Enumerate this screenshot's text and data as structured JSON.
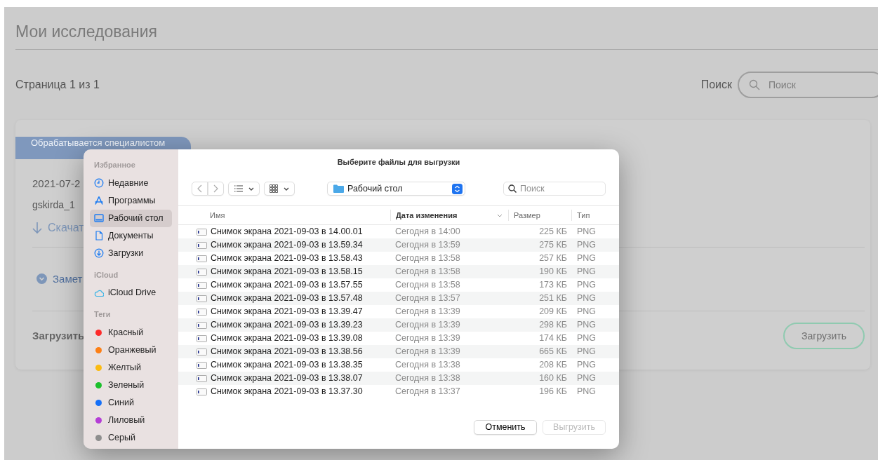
{
  "page": {
    "title": "Мои исследования",
    "pagination": "Страница 1 из 1",
    "search_label": "Поиск",
    "search": {
      "placeholder": "Поиск"
    },
    "card": {
      "status": "Обрабатывается специалистом",
      "date": "2021-07-2",
      "user": "gskirda_1",
      "download_link": "Скачат",
      "notes_toggle": "Замет",
      "upload_label": "Загрузить",
      "upload_button": "Загрузить"
    }
  },
  "dialog": {
    "title": "Выберите файлы для выгрузки",
    "location": "Рабочий стол",
    "search": {
      "placeholder": "Поиск"
    },
    "sidebar": [
      {
        "heading": "Избранное",
        "items": [
          {
            "label": "Недавние",
            "kind": "clock",
            "selected": false
          },
          {
            "label": "Программы",
            "kind": "apps",
            "selected": false
          },
          {
            "label": "Рабочий стол",
            "kind": "desktop",
            "selected": true
          },
          {
            "label": "Документы",
            "kind": "document",
            "selected": false
          },
          {
            "label": "Загрузки",
            "kind": "download",
            "selected": false
          }
        ]
      },
      {
        "heading": "iCloud",
        "items": [
          {
            "label": "iCloud Drive",
            "kind": "cloud",
            "selected": false
          }
        ]
      },
      {
        "heading": "Теги",
        "items": [
          {
            "label": "Красный",
            "kind": "tag",
            "color": "#fe2b2b",
            "selected": false
          },
          {
            "label": "Оранжевый",
            "kind": "tag",
            "color": "#fd7f16",
            "selected": false
          },
          {
            "label": "Желтый",
            "kind": "tag",
            "color": "#fbbb12",
            "selected": false
          },
          {
            "label": "Зеленый",
            "kind": "tag",
            "color": "#1cc02c",
            "selected": false
          },
          {
            "label": "Синий",
            "kind": "tag",
            "color": "#1670f8",
            "selected": false
          },
          {
            "label": "Лиловый",
            "kind": "tag",
            "color": "#b53ed6",
            "selected": false
          },
          {
            "label": "Серый",
            "kind": "tag",
            "color": "#8e8e8e",
            "selected": false
          }
        ]
      }
    ],
    "columns": [
      {
        "label": "Имя",
        "sorted": false
      },
      {
        "label": "Дата изменения",
        "sorted": true
      },
      {
        "label": "Размер",
        "sorted": false
      },
      {
        "label": "Тип",
        "sorted": false
      }
    ],
    "files": [
      {
        "name": "Снимок экрана 2021-09-03 в 14.00.01",
        "date": "Сегодня в 14:00",
        "size": "225 КБ",
        "type": "PNG"
      },
      {
        "name": "Снимок экрана 2021-09-03 в 13.59.34",
        "date": "Сегодня в 13:59",
        "size": "275 КБ",
        "type": "PNG"
      },
      {
        "name": "Снимок экрана 2021-09-03 в 13.58.43",
        "date": "Сегодня в 13:58",
        "size": "257 КБ",
        "type": "PNG"
      },
      {
        "name": "Снимок экрана 2021-09-03 в 13.58.15",
        "date": "Сегодня в 13:58",
        "size": "190 КБ",
        "type": "PNG"
      },
      {
        "name": "Снимок экрана 2021-09-03 в 13.57.55",
        "date": "Сегодня в 13:58",
        "size": "173 КБ",
        "type": "PNG"
      },
      {
        "name": "Снимок экрана 2021-09-03 в 13.57.48",
        "date": "Сегодня в 13:57",
        "size": "251 КБ",
        "type": "PNG"
      },
      {
        "name": "Снимок экрана 2021-09-03 в 13.39.47",
        "date": "Сегодня в 13:39",
        "size": "209 КБ",
        "type": "PNG"
      },
      {
        "name": "Снимок экрана 2021-09-03 в 13.39.23",
        "date": "Сегодня в 13:39",
        "size": "298 КБ",
        "type": "PNG"
      },
      {
        "name": "Снимок экрана 2021-09-03 в 13.39.08",
        "date": "Сегодня в 13:39",
        "size": "174 КБ",
        "type": "PNG"
      },
      {
        "name": "Снимок экрана 2021-09-03 в 13.38.56",
        "date": "Сегодня в 13:39",
        "size": "665 КБ",
        "type": "PNG"
      },
      {
        "name": "Снимок экрана 2021-09-03 в 13.38.35",
        "date": "Сегодня в 13:38",
        "size": "208 КБ",
        "type": "PNG"
      },
      {
        "name": "Снимок экрана 2021-09-03 в 13.38.07",
        "date": "Сегодня в 13:38",
        "size": "160 КБ",
        "type": "PNG"
      },
      {
        "name": "Снимок экрана 2021-09-03 в 13.37.30",
        "date": "Сегодня в 13:37",
        "size": "196 КБ",
        "type": "PNG"
      }
    ],
    "buttons": [
      {
        "label": "Отменить",
        "disabled": false
      },
      {
        "label": "Выгрузить",
        "disabled": true
      }
    ]
  }
}
